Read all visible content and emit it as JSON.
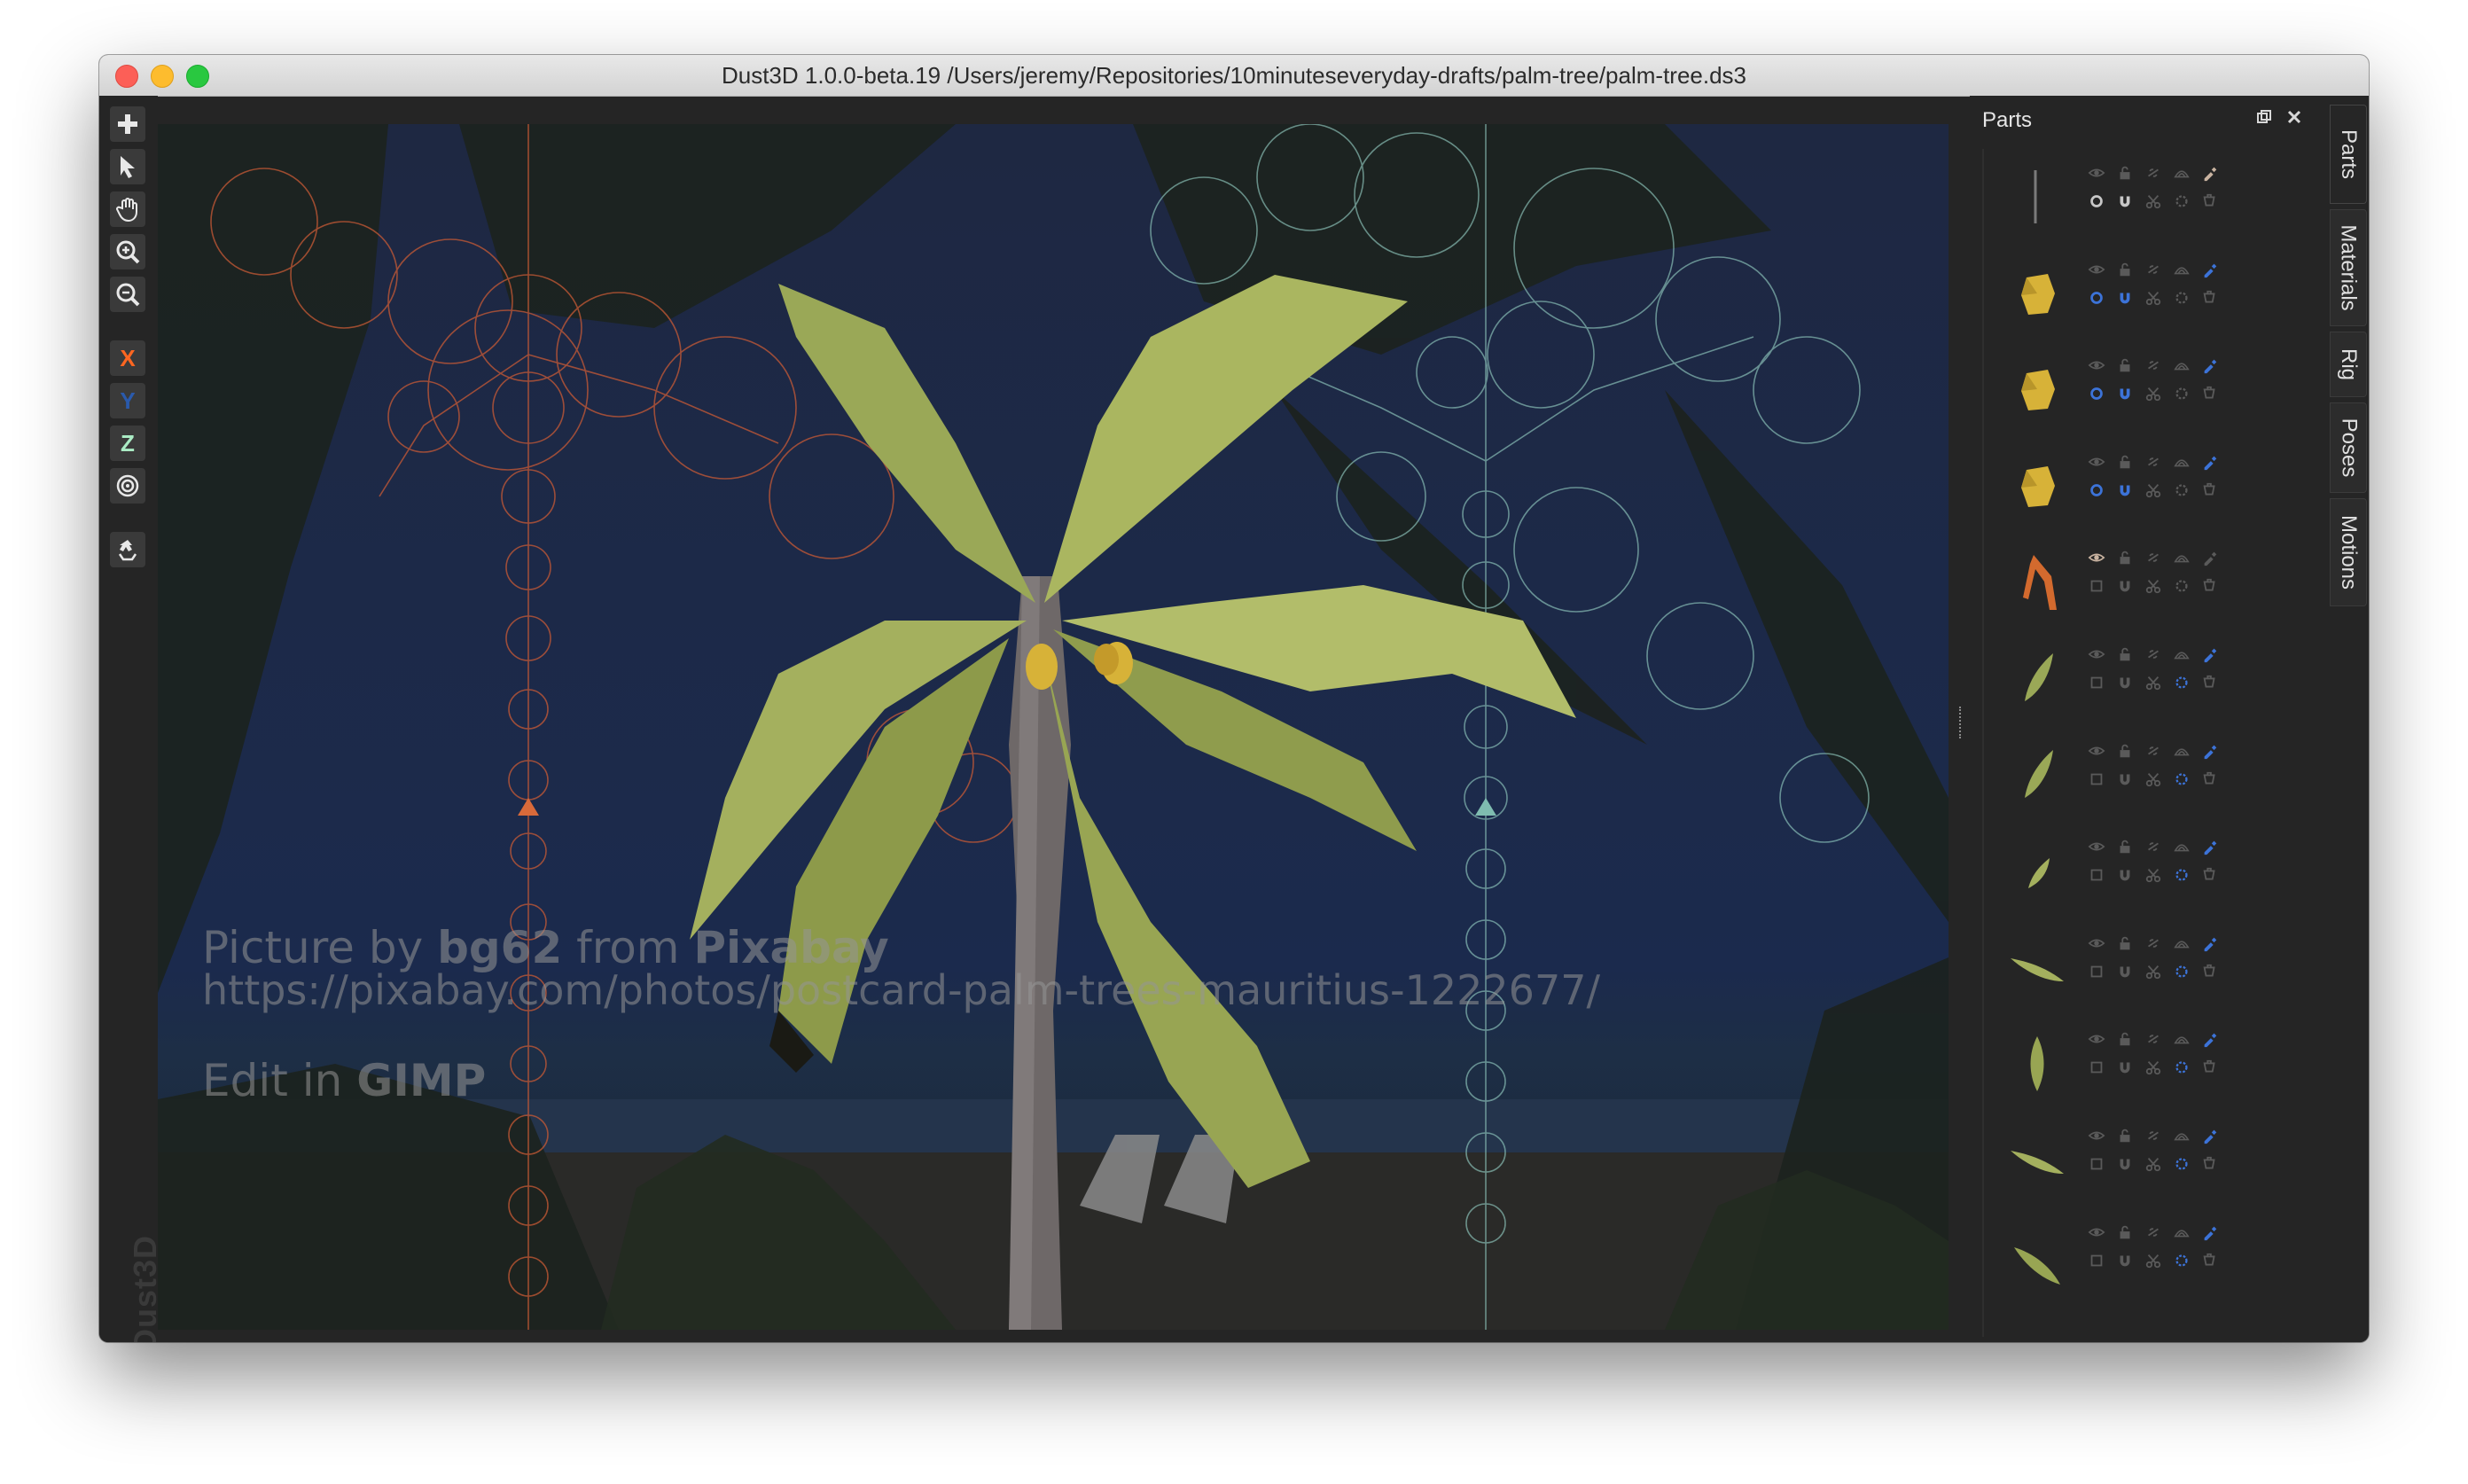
{
  "window": {
    "title": "Dust3D 1.0.0-beta.19 /Users/jeremy/Repositories/10minuteseveryday-drafts/palm-tree/palm-tree.ds3"
  },
  "toolbar": {
    "tools": [
      {
        "name": "add-icon",
        "interactable": true
      },
      {
        "name": "select-icon",
        "interactable": true
      },
      {
        "name": "hand-icon",
        "interactable": true
      },
      {
        "name": "zoom-in-icon",
        "interactable": true
      },
      {
        "name": "zoom-out-icon",
        "interactable": true
      }
    ],
    "axis_x_label": "X",
    "axis_y_label": "Y",
    "axis_z_label": "Z",
    "radial_icon": "radial-lock-icon",
    "regenerate_icon": "regenerate-icon",
    "brand_label": "Dust3D",
    "colors": {
      "x": "#fc6621",
      "y": "#2a5aac",
      "z": "#aaebc4"
    }
  },
  "canvas": {
    "watermark_line1_prefix": "Picture by ",
    "watermark_line1_author": "bg62",
    "watermark_line1_middle": " from ",
    "watermark_line1_site": "Pixabay",
    "watermark_line2": "https://pixabay.com/photos/postcard-palm-trees-mauritius-1222677/",
    "watermark_line3_prefix": "Edit in ",
    "watermark_line3_tool": "GIMP",
    "front_view_color": "#e0603a",
    "side_view_color": "#8fc7bd",
    "leaf_color": "#a6b35a",
    "trunk_color": "#6e6868"
  },
  "parts_panel": {
    "title": "Parts",
    "float_icon": "float-window-icon",
    "close_icon": "close-icon",
    "parts": [
      {
        "thumbnail": "stick",
        "color_picker": "tan",
        "row2_state": "light"
      },
      {
        "thumbnail": "coconut",
        "color_picker": "blue",
        "row2_state": "blue"
      },
      {
        "thumbnail": "coconut",
        "color_picker": "blue",
        "row2_state": "blue"
      },
      {
        "thumbnail": "coconut",
        "color_picker": "blue",
        "row2_state": "blue"
      },
      {
        "thumbnail": "trunk",
        "color_picker": "dim",
        "row2_state": "dim"
      },
      {
        "thumbnail": "leaf",
        "color_picker": "blue",
        "row2_state": "leaf"
      },
      {
        "thumbnail": "leaf",
        "color_picker": "blue",
        "row2_state": "leaf"
      },
      {
        "thumbnail": "leaf-small",
        "color_picker": "blue",
        "row2_state": "leaf"
      },
      {
        "thumbnail": "leaf-flat",
        "color_picker": "blue",
        "row2_state": "leaf"
      },
      {
        "thumbnail": "leaf-upright",
        "color_picker": "blue",
        "row2_state": "leaf"
      },
      {
        "thumbnail": "leaf-flat",
        "color_picker": "blue",
        "row2_state": "leaf"
      },
      {
        "thumbnail": "leaf-diag",
        "color_picker": "blue",
        "row2_state": "leaf"
      }
    ]
  },
  "side_tabs": [
    "Parts",
    "Materials",
    "Rig",
    "Poses",
    "Motions"
  ]
}
